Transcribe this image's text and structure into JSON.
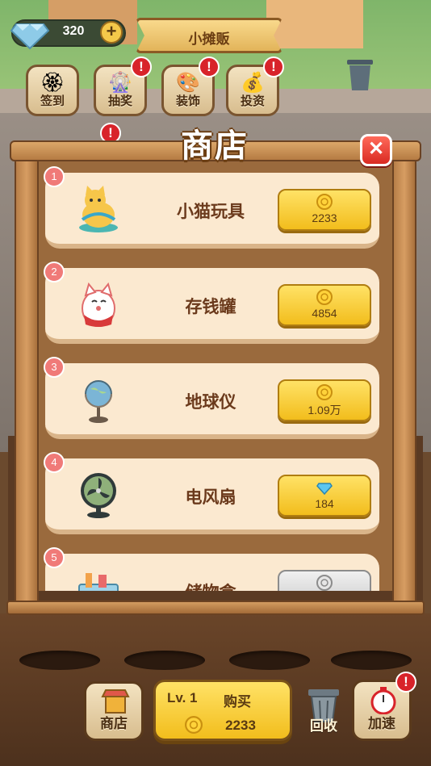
{
  "hud": {
    "gems": "320",
    "plus_label": "+",
    "title": "小摊贩",
    "buttons": [
      {
        "label": "签到",
        "icon": "stamp-icon"
      },
      {
        "label": "抽奖",
        "icon": "wheel-icon"
      },
      {
        "label": "装饰",
        "icon": "decor-icon"
      },
      {
        "label": "投资",
        "icon": "invest-icon"
      }
    ],
    "badge_mark": "!"
  },
  "shop": {
    "title": "商店",
    "close_label": "✕",
    "items": [
      {
        "num": "1",
        "name": "小猫玩具",
        "price": "2233",
        "currency": "coin",
        "icon": "cat-toy-icon"
      },
      {
        "num": "2",
        "name": "存钱罐",
        "price": "4854",
        "currency": "coin",
        "icon": "piggy-bank-icon"
      },
      {
        "num": "3",
        "name": "地球仪",
        "price": "1.09万",
        "currency": "coin",
        "icon": "globe-icon"
      },
      {
        "num": "4",
        "name": "电风扇",
        "price": "184",
        "currency": "diamond",
        "icon": "fan-icon"
      },
      {
        "num": "5",
        "name": "储物盒",
        "price": "",
        "currency": "coin",
        "icon": "storage-box-icon"
      }
    ]
  },
  "bottom": {
    "shop_label": "商店",
    "level": "Lv. 1",
    "buy_label": "购买",
    "cost": "2233",
    "recycle_label": "回收",
    "speed_label": "加速"
  },
  "colors": {
    "accent_yellow": "#f2bd1c",
    "badge_red": "#d8232a",
    "card_bg": "#fbe9d0",
    "wood": "#b77e48"
  }
}
